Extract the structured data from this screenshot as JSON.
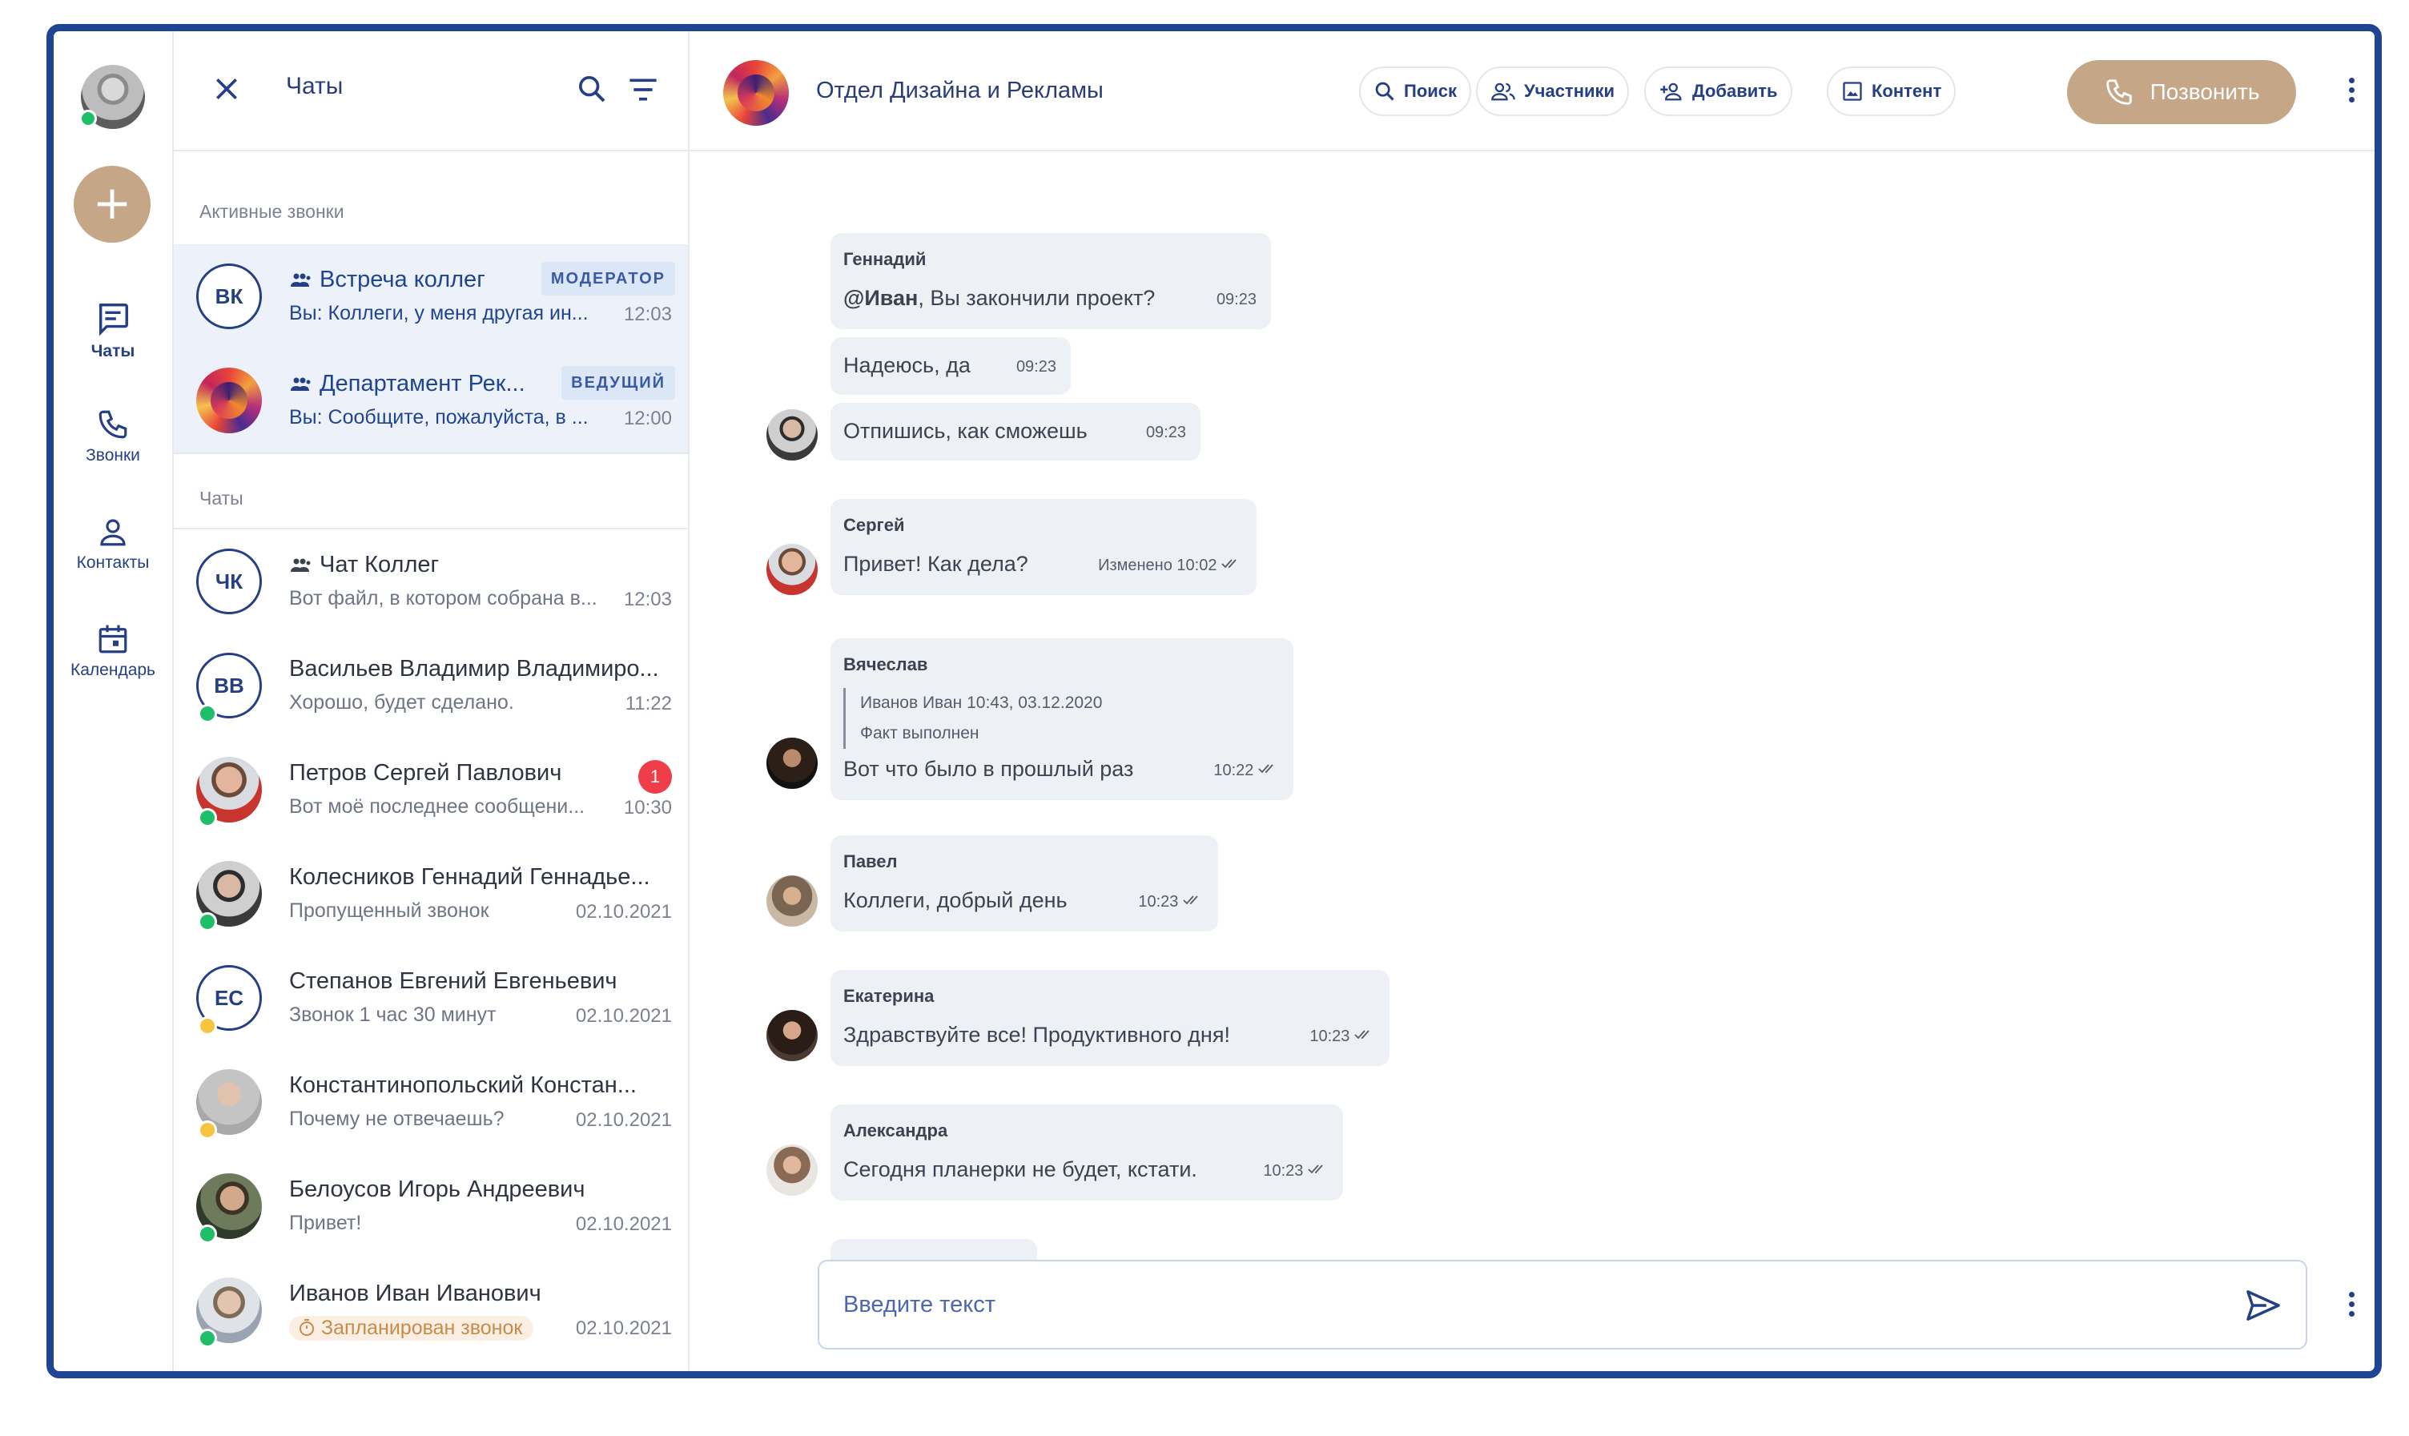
{
  "rail": {
    "nav": [
      {
        "label": "Чаты"
      },
      {
        "label": "Звонки"
      },
      {
        "label": "Контакты"
      },
      {
        "label": "Календарь"
      }
    ]
  },
  "list": {
    "title": "Чаты",
    "active_calls_label": "Активные звонки",
    "chats_label": "Чаты",
    "active_calls": [
      {
        "initials": "ВК",
        "name": "Встреча коллег",
        "role": "МОДЕРАТОР",
        "preview": "Вы: Коллеги, у меня другая ин...",
        "time": "12:03"
      },
      {
        "name": "Департамент Рек...",
        "role": "ВЕДУЩИЙ",
        "preview": "Вы: Сообщите, пожалуйста, в ...",
        "time": "12:00"
      }
    ],
    "chats": [
      {
        "initials": "ЧК",
        "name": "Чат Коллег",
        "preview": "Вот файл, в котором собрана в...",
        "time": "12:03"
      },
      {
        "initials": "ВВ",
        "name": "Васильев Владимир Владимиро...",
        "preview": "Хорошо, будет сделано.",
        "time": "11:22"
      },
      {
        "name": "Петров Сергей Павлович",
        "preview": "Вот моё последнее сообщени...",
        "time": "10:30",
        "badge": "1"
      },
      {
        "name": "Колесников Геннадий Геннадье...",
        "preview": "Пропущенный звонок",
        "time": "02.10.2021"
      },
      {
        "initials": "ЕС",
        "name": "Степанов Евгений Евгеньевич",
        "preview": "Звонок 1 час 30 минут",
        "time": "02.10.2021"
      },
      {
        "name": "Константинопольский Констан...",
        "preview": "Почему не отвечаешь?",
        "time": "02.10.2021"
      },
      {
        "name": "Белоусов Игорь Андреевич",
        "preview": "Привет!",
        "time": "02.10.2021"
      },
      {
        "name": "Иванов Иван Иванович",
        "preview": "Запланирован звонок",
        "time": "02.10.2021"
      }
    ]
  },
  "chat": {
    "title": "Отдел Дизайна и Рекламы",
    "buttons": {
      "search": "Поиск",
      "members": "Участники",
      "add": "Добавить",
      "content": "Контент",
      "call": "Позвонить"
    },
    "messages": [
      {
        "author": "Геннадий",
        "mention": "@Иван",
        "text": ", Вы закончили проект?",
        "time": "09:23"
      },
      {
        "text": "Надеюсь, да",
        "time": "09:23"
      },
      {
        "text": "Отпишись, как сможешь",
        "time": "09:23"
      },
      {
        "author": "Сергей",
        "text": "Привет! Как дела?",
        "time": "Изменено 10:02"
      },
      {
        "author": "Вячеслав",
        "quote_author": "Иванов Иван 10:43, 03.12.2020",
        "quote_text": "Факт выполнен",
        "text": "Вот что было в прошлый раз",
        "time": "10:22"
      },
      {
        "author": "Павел",
        "text": "Коллеги, добрый день",
        "time": "10:23"
      },
      {
        "author": "Екатерина",
        "text": "Здравствуйте все! Продуктивного дня!",
        "time": "10:23"
      },
      {
        "author": "Александра",
        "text": "Сегодня планерки не будет, кстати.",
        "time": "10:23"
      }
    ],
    "composer": {
      "placeholder": "Введите текст"
    }
  },
  "colors": {
    "accent": "#1f4493",
    "brand_tan": "#c5a686",
    "online": "#1fbf6a",
    "away": "#f5c542",
    "unread": "#ef3e4a",
    "bubble": "#edf0f5"
  }
}
